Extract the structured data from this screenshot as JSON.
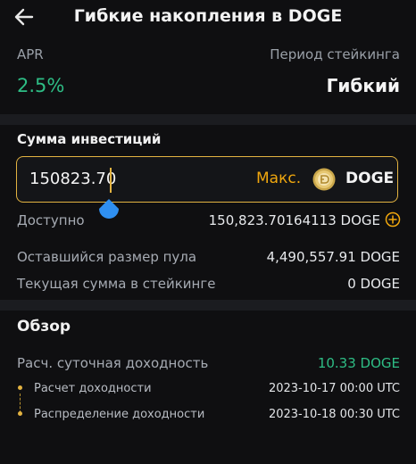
{
  "header": {
    "title": "Гибкие накопления в DOGE",
    "back_icon": "arrow-left-icon"
  },
  "info": {
    "apr_label": "APR",
    "apr_value": "2.5%",
    "period_label": "Период стейкинга",
    "period_value": "Гибкий"
  },
  "investment": {
    "section_title": "Сумма инвестиций",
    "amount_value": "150823.70",
    "max_label": "Макс.",
    "coin_icon": "doge-coin-icon",
    "coin_name": "DOGE",
    "available_label": "Доступно",
    "available_value": "150,823.70164113 DOGE",
    "pool_label": "Оставшийся размер пула",
    "pool_value": "4,490,557.91 DOGE",
    "staking_label": "Текущая сумма в стейкинге",
    "staking_value": "0 DOGE"
  },
  "overview": {
    "title": "Обзор",
    "daily_label": "Расч. суточная доходность",
    "daily_value": "10.33 DOGE",
    "timeline": [
      {
        "label": "Расчет доходности",
        "value": "2023-10-17 00:00 UTC"
      },
      {
        "label": "Распределение доходности",
        "value": "2023-10-18 00:30 UTC"
      }
    ]
  },
  "colors": {
    "accent": "#e3b341",
    "positive": "#2ebd85",
    "max": "#f0a70e"
  }
}
